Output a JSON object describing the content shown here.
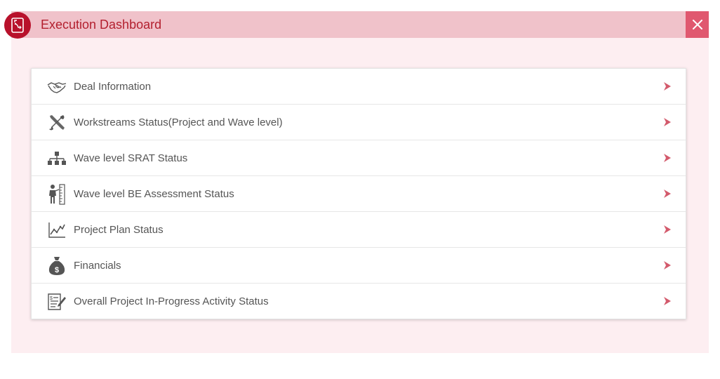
{
  "header": {
    "title": "Execution Dashboard",
    "logo_icon": "clipboard-document-icon",
    "close_icon": "close-icon",
    "bar_color": "#f0c2ca",
    "accent_color": "#b8112b"
  },
  "menu": {
    "items": [
      {
        "label": "Deal Information",
        "icon": "handshake-icon"
      },
      {
        "label": "Workstreams Status(Project and Wave level)",
        "icon": "tools-icon"
      },
      {
        "label": "Wave level SRAT Status",
        "icon": "hierarchy-icon"
      },
      {
        "label": "Wave level BE Assessment Status",
        "icon": "person-measure-icon"
      },
      {
        "label": "Project Plan Status",
        "icon": "line-chart-icon"
      },
      {
        "label": "Financials",
        "icon": "money-bag-icon"
      },
      {
        "label": "Overall Project In-Progress Activity Status",
        "icon": "document-edit-icon"
      }
    ],
    "arrow_icon": "chevron-right-icon",
    "arrow_color": "#d35a6c"
  }
}
